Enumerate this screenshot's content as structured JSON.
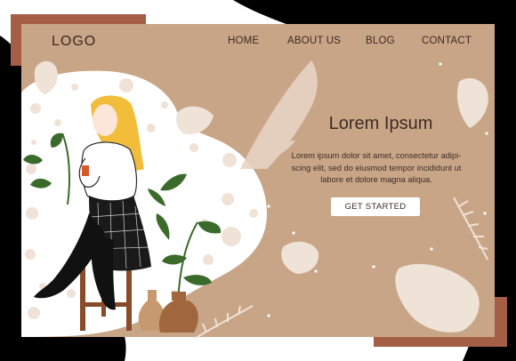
{
  "header": {
    "logo": "LOGO",
    "nav": [
      {
        "label": "HOME"
      },
      {
        "label": "ABOUT US"
      },
      {
        "label": "BLOG"
      },
      {
        "label": "CONTACT"
      }
    ]
  },
  "hero": {
    "title": "Lorem Ipsum",
    "body": "Lorem ipsum dolor sit amet, consectetur adipi-scing elit, sed do eiusmod tempor incididunt ut labore et dolore magna aliqua.",
    "cta_label": "GET STARTED"
  },
  "colors": {
    "page_background": "#c9a588",
    "accent": "#a45e45",
    "text": "#3a2a20",
    "black_shapes": "#000000",
    "button_background": "#ffffff"
  },
  "illustration": {
    "subject": "blonde-woman-sitting-on-stool-with-drink",
    "decor": [
      "monstera-leaf-icons",
      "fern-leaf-icons",
      "potted-plant",
      "vases",
      "polka-dots"
    ]
  }
}
